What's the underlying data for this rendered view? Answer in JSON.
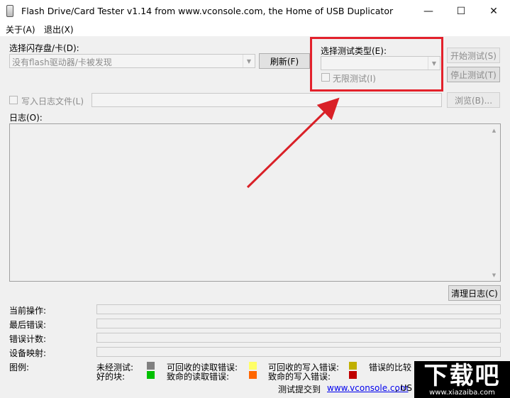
{
  "window": {
    "title": "Flash Drive/Card Tester v1.14 from www.vconsole.com, the Home of USB Duplicator",
    "minimize_glyph": "—",
    "maximize_glyph": "☐",
    "close_glyph": "✕"
  },
  "menu": {
    "about": "关于(A)",
    "exit": "退出(X)"
  },
  "drive": {
    "label": "选择闪存盘/卡(D):",
    "value": "没有flash驱动器/卡被发现",
    "refresh": "刷新(F)"
  },
  "test_type": {
    "label": "选择测试类型(E):",
    "value": "",
    "infinite_label": "无限测试(I)"
  },
  "buttons": {
    "start": "开始测试(S)",
    "stop": "停止测试(T)",
    "browse": "浏览(B)...",
    "clear_log": "清理日志(C)"
  },
  "log_file": {
    "label": "写入日志文件(L)",
    "path": ""
  },
  "log": {
    "label": "日志(O):",
    "content": ""
  },
  "status": {
    "current_op": "当前操作:",
    "last_error": "最后错误:",
    "error_count": "错误计数:",
    "device_map": "设备映射:"
  },
  "legend": {
    "label": "图例:",
    "items": [
      {
        "label": "未经测试:",
        "color": "#808080"
      },
      {
        "label": "好的块:",
        "color": "#00c000"
      },
      {
        "label": "可回收的读取错误:",
        "color": "#ffff66"
      },
      {
        "label": "致命的读取错误:",
        "color": "#ff6600"
      },
      {
        "label": "可回收的写入错误:",
        "color": "#c0b000"
      },
      {
        "label": "致命的写入错误:",
        "color": "#c00000"
      },
      {
        "label": "错误的比较",
        "color": ""
      }
    ]
  },
  "footer": {
    "submit_label": "测试提交到",
    "link": "www.vconsole.com",
    "suffix": ", US"
  },
  "watermark": {
    "text": "下载吧",
    "url": "www.xiazaiba.com"
  },
  "colors": {
    "highlight": "#e3212b",
    "arrow": "#d92027"
  }
}
